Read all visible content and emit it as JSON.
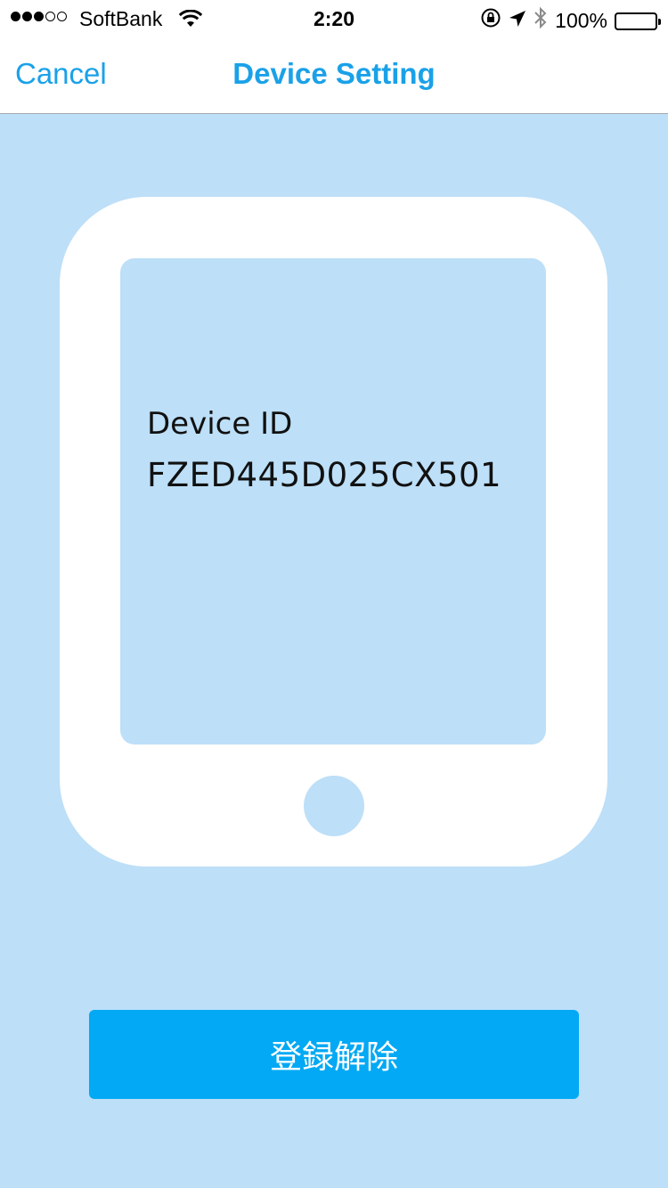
{
  "status_bar": {
    "carrier": "SoftBank",
    "signal_bars_filled": 3,
    "signal_bars_total": 5,
    "time": "2:20",
    "battery_percent": "100%",
    "icons": [
      "wifi-icon",
      "orientation-lock-icon",
      "location-arrow-icon",
      "bluetooth-icon",
      "battery-icon"
    ]
  },
  "nav": {
    "cancel_label": "Cancel",
    "title": "Device Setting"
  },
  "device": {
    "id_label": "Device ID",
    "id_value": "FZED445D025CX501"
  },
  "actions": {
    "unregister_label": "登録解除"
  },
  "colors": {
    "accent": "#1aa1e8",
    "background": "#bddff8",
    "button": "#03a9f4",
    "card": "#ffffff"
  }
}
